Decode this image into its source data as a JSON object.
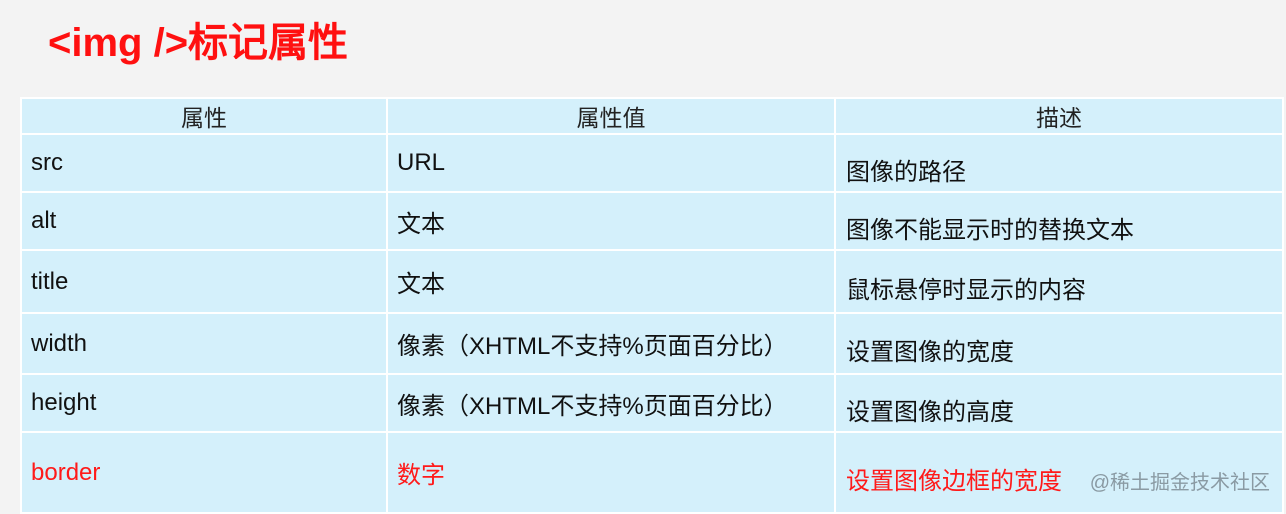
{
  "title": "<img />标记属性",
  "table": {
    "headers": [
      "属性",
      "属性值",
      "描述"
    ],
    "rows": [
      {
        "attr": "src",
        "value": "URL",
        "desc": "图像的路径",
        "highlight": false
      },
      {
        "attr": "alt",
        "value": "文本",
        "desc": "图像不能显示时的替换文本",
        "highlight": false
      },
      {
        "attr": "title",
        "value": "文本",
        "desc": "鼠标悬停时显示的内容",
        "highlight": false
      },
      {
        "attr": "width",
        "value": "像素（XHTML不支持%页面百分比）",
        "desc": "设置图像的宽度",
        "highlight": false
      },
      {
        "attr": "height",
        "value": "像素（XHTML不支持%页面百分比）",
        "desc": "设置图像的高度",
        "highlight": false
      },
      {
        "attr": "border",
        "value": "数字",
        "desc": "设置图像边框的宽度",
        "highlight": true
      }
    ]
  },
  "watermark": "@稀土掘金技术社区",
  "colors": {
    "title": "#ff1010",
    "highlight": "#ff1a1a",
    "cell_bg": "#d4f0fb"
  }
}
